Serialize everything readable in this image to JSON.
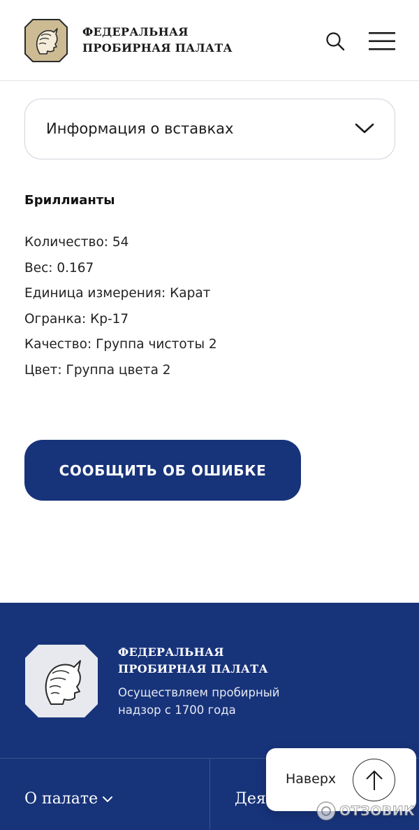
{
  "header": {
    "brand_line1": "ФЕДЕРАЛЬНАЯ",
    "brand_line2": "ПРОБИРНАЯ ПАЛАТА",
    "search_icon": "search-icon",
    "menu_icon": "hamburger-menu-icon"
  },
  "accordion": {
    "title": "Информация о вставках",
    "state": "expanded"
  },
  "inserts": {
    "heading": "Бриллианты",
    "properties": [
      "Количество: 54",
      "Вес: 0.167",
      "Единица измерения: Карат",
      "Огранка: Кр-17",
      "Качество: Группа чистоты 2",
      "Цвет: Группа цвета 2"
    ]
  },
  "report_button": {
    "label": "СООБЩИТЬ ОБ ОШИБКЕ"
  },
  "footer": {
    "brand_line1": "ФЕДЕРАЛЬНАЯ",
    "brand_line2": "ПРОБИРНАЯ ПАЛАТА",
    "tagline": "Осуществляем пробирный надзор с 1700 года",
    "nav": [
      {
        "label": "О палате"
      },
      {
        "label": "Дея"
      }
    ]
  },
  "scroll_up": {
    "label": "Наверх"
  },
  "watermark": {
    "text": "ОТЗОВИК"
  },
  "colors": {
    "primary": "#17337a",
    "badge_gold": "#cdbb94",
    "badge_light": "#e7e9ef",
    "text": "#1c1c1c"
  }
}
